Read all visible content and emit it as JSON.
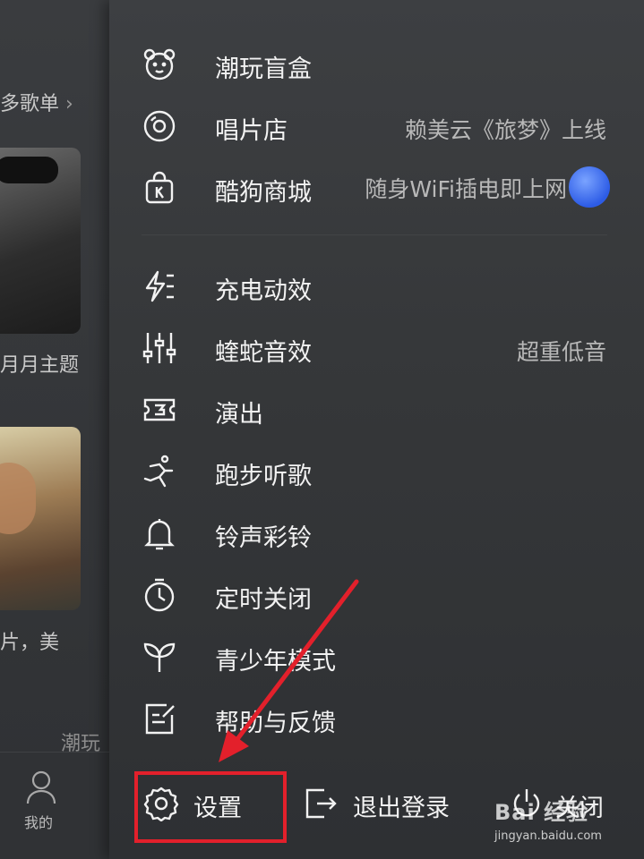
{
  "background": {
    "playlist_link": "多歌单",
    "card1_caption": "月月主题",
    "card2_caption": "片，美",
    "partial_text": "潮玩",
    "nav_mine": "我的"
  },
  "menu": {
    "items": [
      {
        "label": "潮玩盲盒",
        "icon": "bear-face-icon",
        "extra": ""
      },
      {
        "label": "唱片店",
        "icon": "vinyl-record-icon",
        "extra": "赖美云《旅梦》上线"
      },
      {
        "label": "酷狗商城",
        "icon": "shopping-bag-icon",
        "extra": "随身WiFi插电即上网"
      },
      {
        "label": "充电动效",
        "icon": "charging-bolt-icon",
        "extra": ""
      },
      {
        "label": "蝰蛇音效",
        "icon": "equalizer-icon",
        "extra": "超重低音"
      },
      {
        "label": "演出",
        "icon": "ticket-icon",
        "extra": ""
      },
      {
        "label": "跑步听歌",
        "icon": "running-icon",
        "extra": ""
      },
      {
        "label": "铃声彩铃",
        "icon": "bell-icon",
        "extra": ""
      },
      {
        "label": "定时关闭",
        "icon": "timer-icon",
        "extra": ""
      },
      {
        "label": "青少年模式",
        "icon": "sprout-icon",
        "extra": ""
      },
      {
        "label": "帮助与反馈",
        "icon": "feedback-edit-icon",
        "extra": ""
      }
    ]
  },
  "bottom_bar": {
    "settings": "设置",
    "logout": "退出登录",
    "close": "关闭"
  },
  "watermark": {
    "brand": "Bai 经验",
    "url": "jingyan.baidu.com"
  },
  "colors": {
    "drawer_bg": "#3a3c3f",
    "highlight": "#e3202b",
    "text": "#f2f2f2",
    "secondary_text": "#b8b8b8",
    "wifi_badge": "#2d5ce6"
  }
}
